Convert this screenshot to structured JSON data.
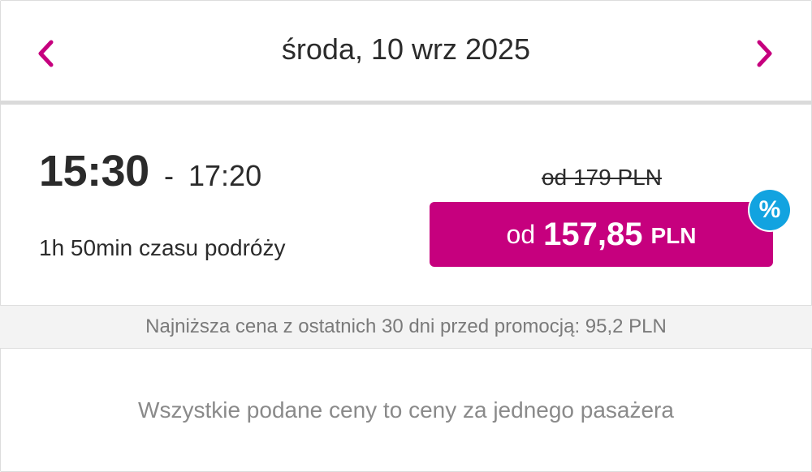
{
  "header": {
    "date": "środa, 10 wrz 2025",
    "prev_icon": "chevron-left-icon",
    "next_icon": "chevron-right-icon"
  },
  "trip": {
    "departure": "15:30",
    "separator": "-",
    "arrival": "17:20",
    "duration": "1h 50min czasu podróży"
  },
  "price": {
    "old": "od 179 PLN",
    "prefix": "od",
    "value": "157,85",
    "currency": "PLN",
    "badge": "%",
    "badge_icon": "percent-badge-icon"
  },
  "info": {
    "lowest_price_note": "Najniższa cena z ostatnich 30 dni przed promocją: 95,2 PLN"
  },
  "footer": {
    "note": "Wszystkie podane ceny to ceny za jednego pasażera"
  },
  "colors": {
    "accent": "#c6007e",
    "badge": "#12a3e0",
    "text": "#2b2b2b",
    "muted": "#8a8a8a"
  }
}
